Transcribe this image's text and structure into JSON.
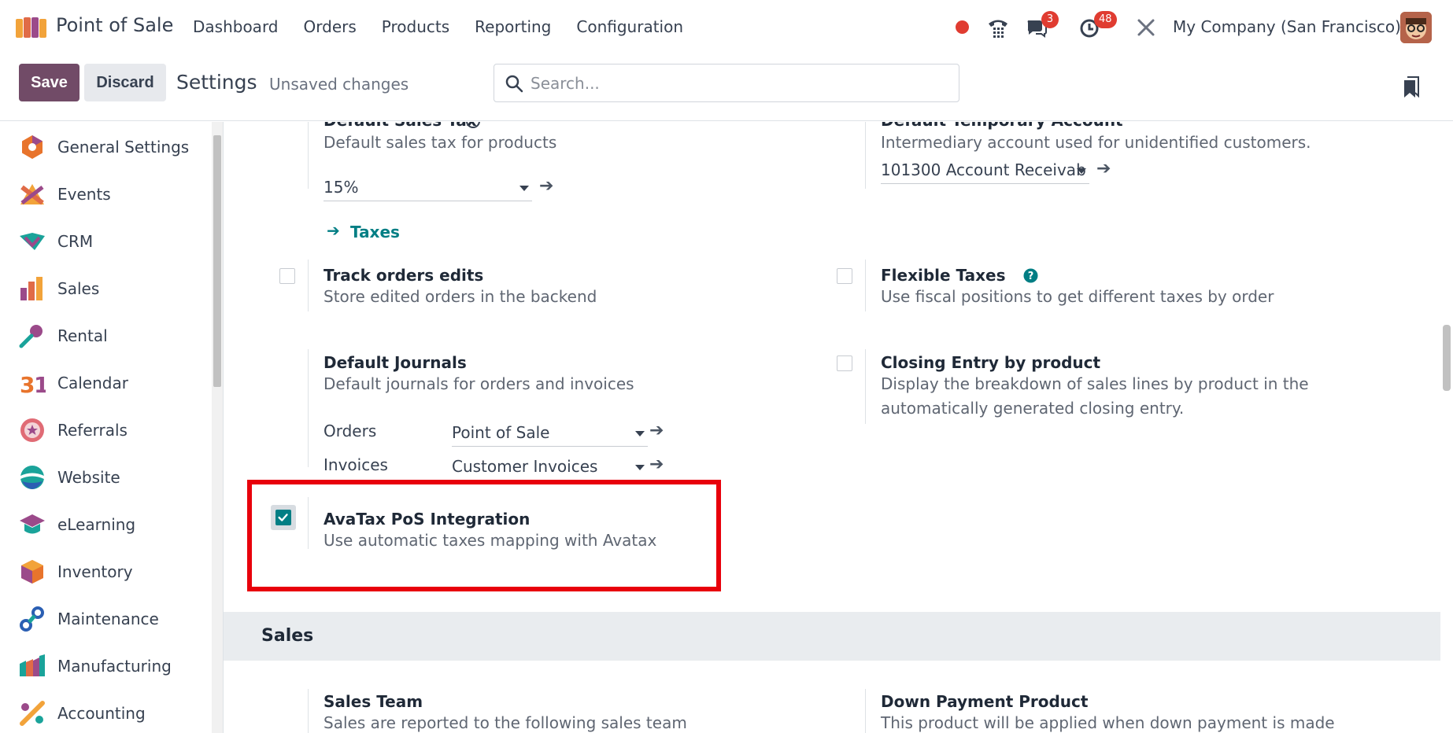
{
  "navbar": {
    "app_title": "Point of Sale",
    "menu": [
      "Dashboard",
      "Orders",
      "Products",
      "Reporting",
      "Configuration"
    ],
    "chat_badge": "3",
    "activity_badge": "48",
    "company": "My Company (San Francisco)"
  },
  "control": {
    "save_label": "Save",
    "discard_label": "Discard",
    "title": "Settings",
    "status": "Unsaved changes",
    "search_placeholder": "Search..."
  },
  "sidebar": {
    "items": [
      {
        "label": "General Settings",
        "icon": "general-settings-icon"
      },
      {
        "label": "Events",
        "icon": "events-icon"
      },
      {
        "label": "CRM",
        "icon": "crm-icon"
      },
      {
        "label": "Sales",
        "icon": "sales-icon"
      },
      {
        "label": "Rental",
        "icon": "rental-icon"
      },
      {
        "label": "Calendar",
        "icon": "calendar-icon"
      },
      {
        "label": "Referrals",
        "icon": "referrals-icon"
      },
      {
        "label": "Website",
        "icon": "website-icon"
      },
      {
        "label": "eLearning",
        "icon": "elearning-icon"
      },
      {
        "label": "Inventory",
        "icon": "inventory-icon"
      },
      {
        "label": "Maintenance",
        "icon": "maintenance-icon"
      },
      {
        "label": "Manufacturing",
        "icon": "manufacturing-icon"
      },
      {
        "label": "Accounting",
        "icon": "accounting-icon"
      }
    ]
  },
  "settings": {
    "sales_tax": {
      "title": "Default Sales Tax",
      "desc": "Default sales tax for products",
      "value": "15%",
      "link": "Taxes"
    },
    "temp_account": {
      "title": "Default Temporary Account",
      "desc": "Intermediary account used for unidentified customers.",
      "value": "101300 Account Receivab"
    },
    "track_orders": {
      "title": "Track orders edits",
      "desc": "Store edited orders in the backend"
    },
    "flexible_taxes": {
      "title": "Flexible Taxes",
      "desc": "Use fiscal positions to get different taxes by order"
    },
    "journals": {
      "title": "Default Journals",
      "desc": "Default journals for orders and invoices",
      "orders_label": "Orders",
      "orders_value": "Point of Sale",
      "invoices_label": "Invoices",
      "invoices_value": "Customer Invoices"
    },
    "closing_entry": {
      "title": "Closing Entry by product",
      "desc_line1": "Display the breakdown of sales lines by product in the",
      "desc_line2": "automatically generated closing entry."
    },
    "avatax": {
      "title": "AvaTax PoS Integration",
      "desc": "Use automatic taxes mapping with Avatax",
      "checked": true
    },
    "section_sales": "Sales",
    "sales_team": {
      "title": "Sales Team",
      "desc": "Sales are reported to the following sales team"
    },
    "down_payment": {
      "title": "Down Payment Product",
      "desc": "This product will be applied when down payment is made"
    }
  },
  "colors": {
    "primary": "#714b67",
    "accent": "#017e84",
    "badge": "#e03c31",
    "highlight": "#e8000b"
  }
}
